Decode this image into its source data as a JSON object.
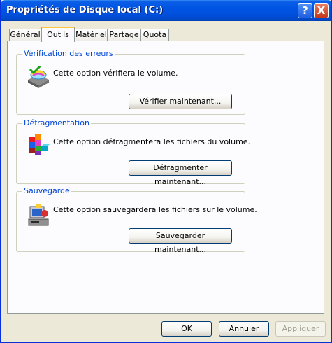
{
  "window": {
    "title": "Propriétés de Disque local (C:)"
  },
  "title_buttons": {
    "help": "?",
    "close": "X"
  },
  "tabs": [
    "Général",
    "Outils",
    "Matériel",
    "Partage",
    "Quota"
  ],
  "active_tab": "Outils",
  "groups": [
    {
      "title": "Vérification des erreurs",
      "description": "Cette option vérifiera le volume.",
      "button": "Vérifier maintenant...",
      "icon": "disk-check-icon"
    },
    {
      "title": "Défragmentation",
      "description": "Cette option défragmentera les fichiers du volume.",
      "button": "Défragmenter maintenant...",
      "icon": "defrag-icon"
    },
    {
      "title": "Sauvegarde",
      "description": "Cette option sauvegardera les fichiers sur le volume.",
      "button": "Sauvegarder maintenant...",
      "icon": "backup-icon"
    }
  ],
  "footer": {
    "ok": "OK",
    "cancel": "Annuler",
    "apply": "Appliquer"
  }
}
